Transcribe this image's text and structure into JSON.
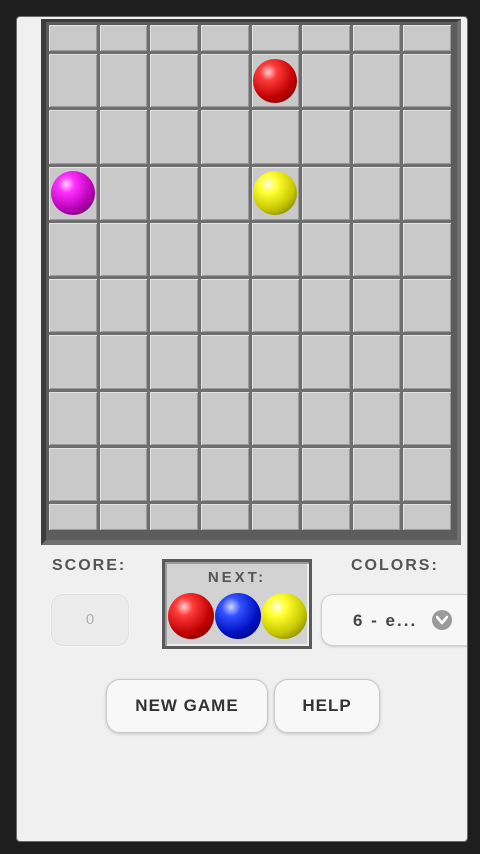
{
  "board": {
    "columns": 8,
    "rows": 10,
    "balls": [
      {
        "row": 1,
        "col": 4,
        "color": "red"
      },
      {
        "row": 3,
        "col": 0,
        "color": "magenta"
      },
      {
        "row": 3,
        "col": 4,
        "color": "yellow"
      }
    ]
  },
  "score": {
    "label": "SCORE:",
    "value": "0"
  },
  "next": {
    "label": "NEXT:",
    "balls": [
      "red",
      "blue",
      "yellow"
    ]
  },
  "colors": {
    "label": "COLORS:",
    "value": "6 - e..."
  },
  "buttons": {
    "new_game": "NEW GAME",
    "help": "HELP"
  },
  "palette": {
    "red": "#e00000",
    "yellow": "#e8e800",
    "magenta": "#d000d0",
    "blue": "#1030e0",
    "cell": "#c9c9c9",
    "grid_line": "#6e6e6e"
  }
}
